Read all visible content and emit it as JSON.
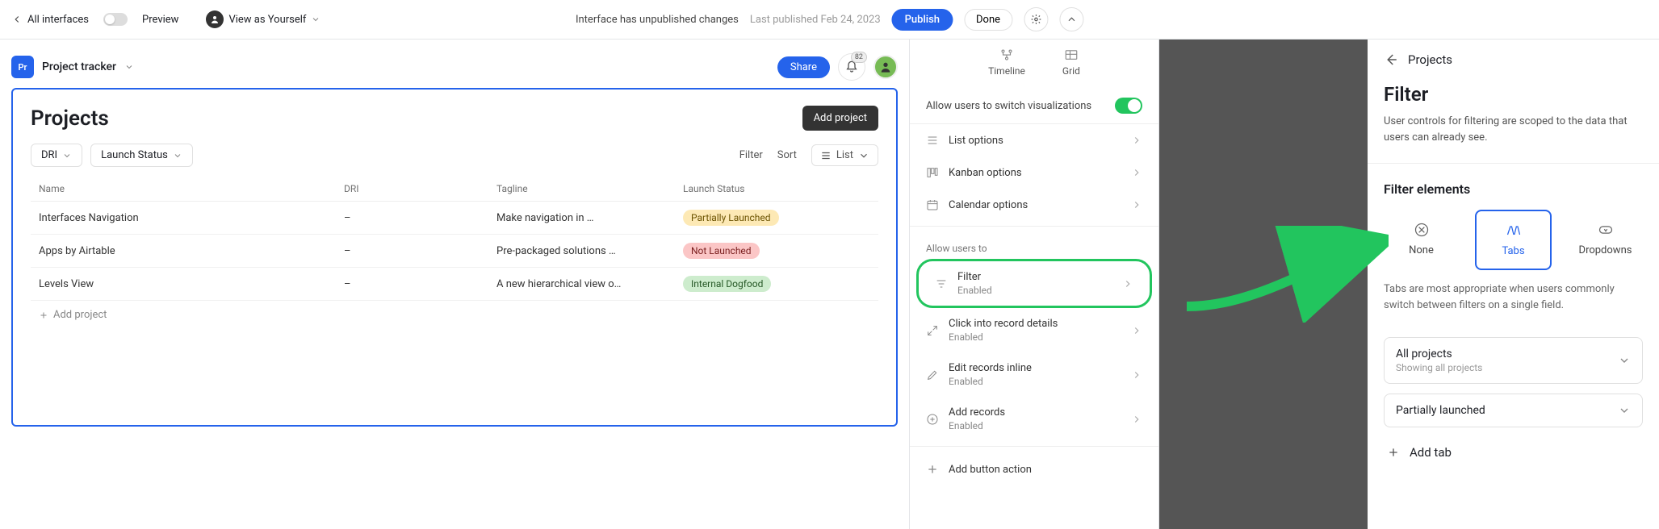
{
  "topbar": {
    "all_interfaces": "All interfaces",
    "preview": "Preview",
    "view_as": "View as Yourself",
    "center_msg": "Interface has unpublished changes",
    "last_published": "Last published Feb 24, 2023",
    "publish": "Publish",
    "done": "Done"
  },
  "canvas": {
    "badge": "Pr",
    "tracker": "Project tracker",
    "share": "Share",
    "notif_count": "82",
    "page_title": "Projects",
    "add_project": "Add project",
    "pill_dri": "DRI",
    "pill_status": "Launch Status",
    "filter": "Filter",
    "sort": "Sort",
    "list_view": "List",
    "columns": {
      "name": "Name",
      "dri": "DRI",
      "tagline": "Tagline",
      "status": "Launch Status"
    },
    "rows": [
      {
        "name": "Interfaces Navigation",
        "dri": "–",
        "tagline": "Make navigation in …",
        "status": "Partially Launched",
        "status_class": "partial"
      },
      {
        "name": "Apps by Airtable",
        "dri": "–",
        "tagline": "Pre-packaged solutions …",
        "status": "Not Launched",
        "status_class": "not"
      },
      {
        "name": "Levels View",
        "dri": "–",
        "tagline": "A new hierarchical view o…",
        "status": "Internal Dogfood",
        "status_class": "internal"
      }
    ],
    "add_row": "Add project"
  },
  "settings": {
    "viz_timeline": "Timeline",
    "viz_grid": "Grid",
    "allow_switch": "Allow users to switch visualizations",
    "list_options": "List options",
    "kanban_options": "Kanban options",
    "calendar_options": "Calendar options",
    "allow_users_to": "Allow users to",
    "filter": "Filter",
    "filter_sub": "Enabled",
    "click_details": "Click into record details",
    "click_details_sub": "Enabled",
    "edit_inline": "Edit records inline",
    "edit_inline_sub": "Enabled",
    "add_records": "Add records",
    "add_records_sub": "Enabled",
    "add_button_action": "Add button action"
  },
  "rightpanel": {
    "breadcrumb": "Projects",
    "title": "Filter",
    "desc": "User controls for filtering are scoped to the data that users can already see.",
    "subtitle": "Filter elements",
    "opt_none": "None",
    "opt_tabs": "Tabs",
    "opt_dropdowns": "Dropdowns",
    "tabs_note": "Tabs are most appropriate when users commonly switch between filters on a single field.",
    "tab1_title": "All projects",
    "tab1_sub": "Showing all projects",
    "tab2_title": "Partially launched",
    "add_tab": "Add tab"
  }
}
